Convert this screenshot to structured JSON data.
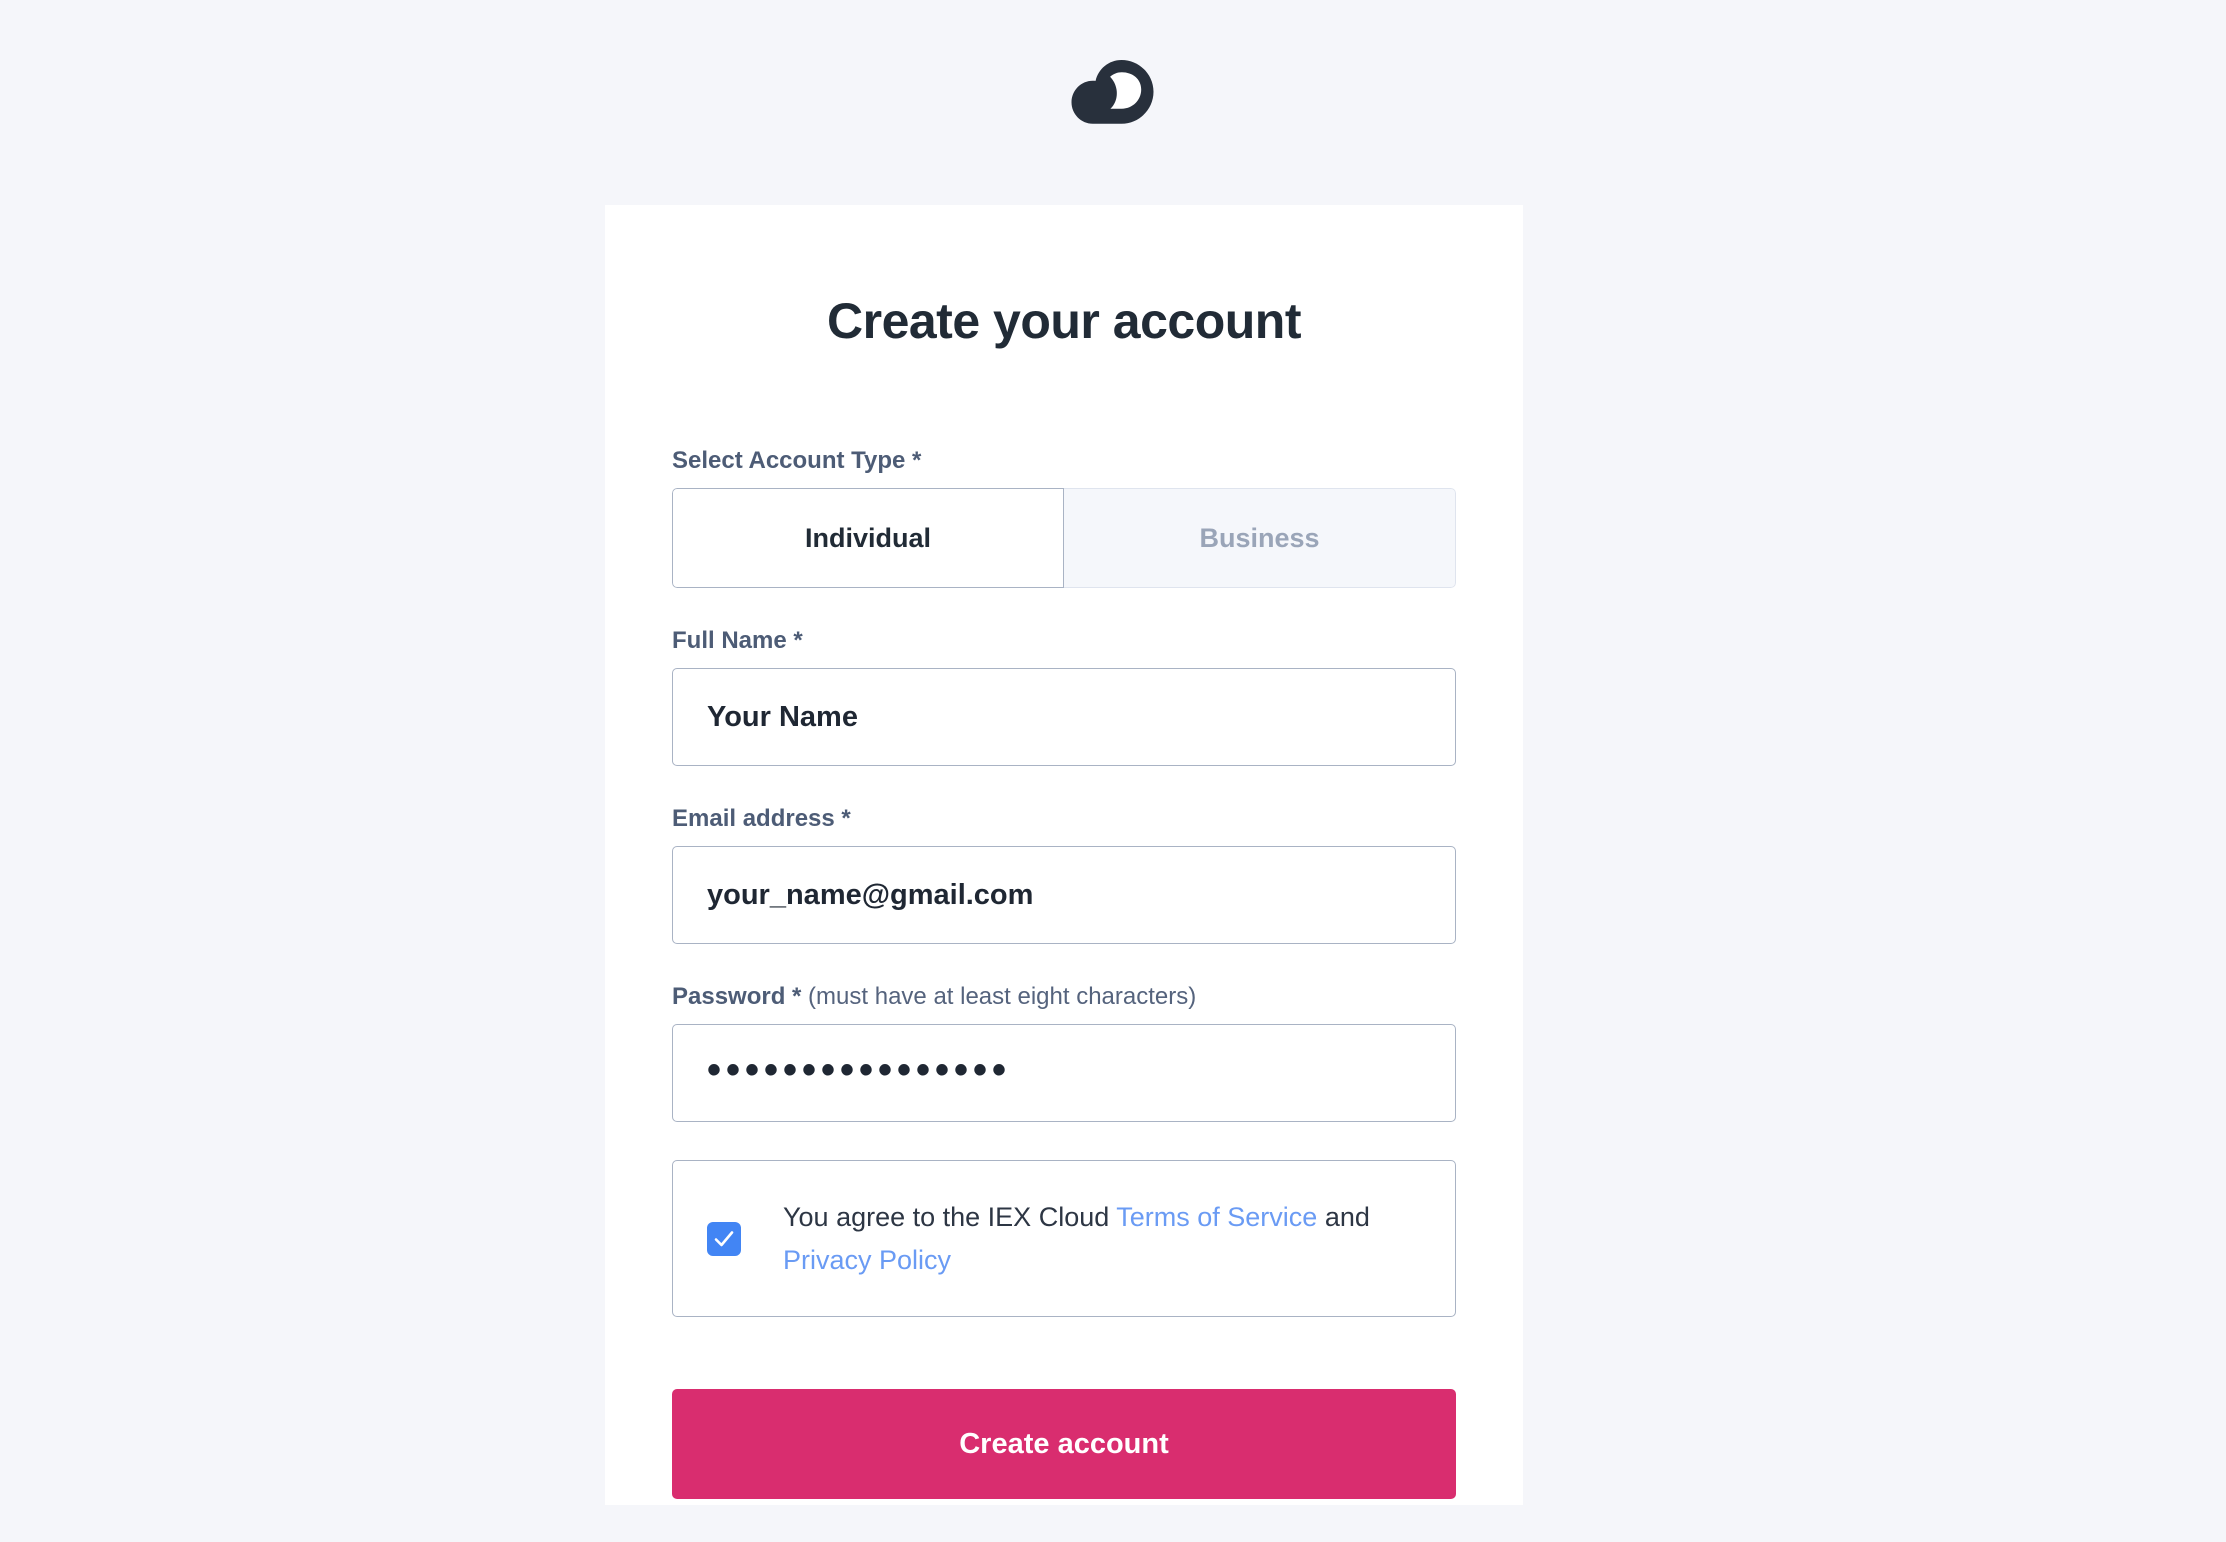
{
  "brand": {
    "logo_icon": "cloud-icon",
    "logo_color": "#28303c"
  },
  "card": {
    "title": "Create your account"
  },
  "form": {
    "account_type": {
      "label": "Select Account Type *",
      "options": [
        {
          "label": "Individual",
          "selected": true
        },
        {
          "label": "Business",
          "selected": false
        }
      ]
    },
    "full_name": {
      "label": "Full Name *",
      "value": "Your Name",
      "placeholder": "Your Name"
    },
    "email": {
      "label": "Email address *",
      "value": "your_name@gmail.com",
      "placeholder": "your_name@gmail.com"
    },
    "password": {
      "label_strong": "Password *",
      "label_hint": " (must have at least eight characters)",
      "masked_value": "••••••••••••••••",
      "character_count": 16
    },
    "terms": {
      "checked": true,
      "checkbox_icon": "check-icon",
      "text_before": "You agree to the IEX Cloud ",
      "link_terms": "Terms of Service",
      "text_middle": " and ",
      "link_privacy": "Privacy Policy"
    },
    "submit": {
      "label": "Create account"
    }
  },
  "colors": {
    "page_background": "#f5f6fa",
    "card_background": "#ffffff",
    "accent_pink": "#d92d6f",
    "link_blue": "#6a9bf4",
    "checkbox_blue": "#4285f4",
    "border_slate": "#a9b3c4",
    "label_slate": "#4d5c76",
    "heading_dark": "#212b36"
  }
}
